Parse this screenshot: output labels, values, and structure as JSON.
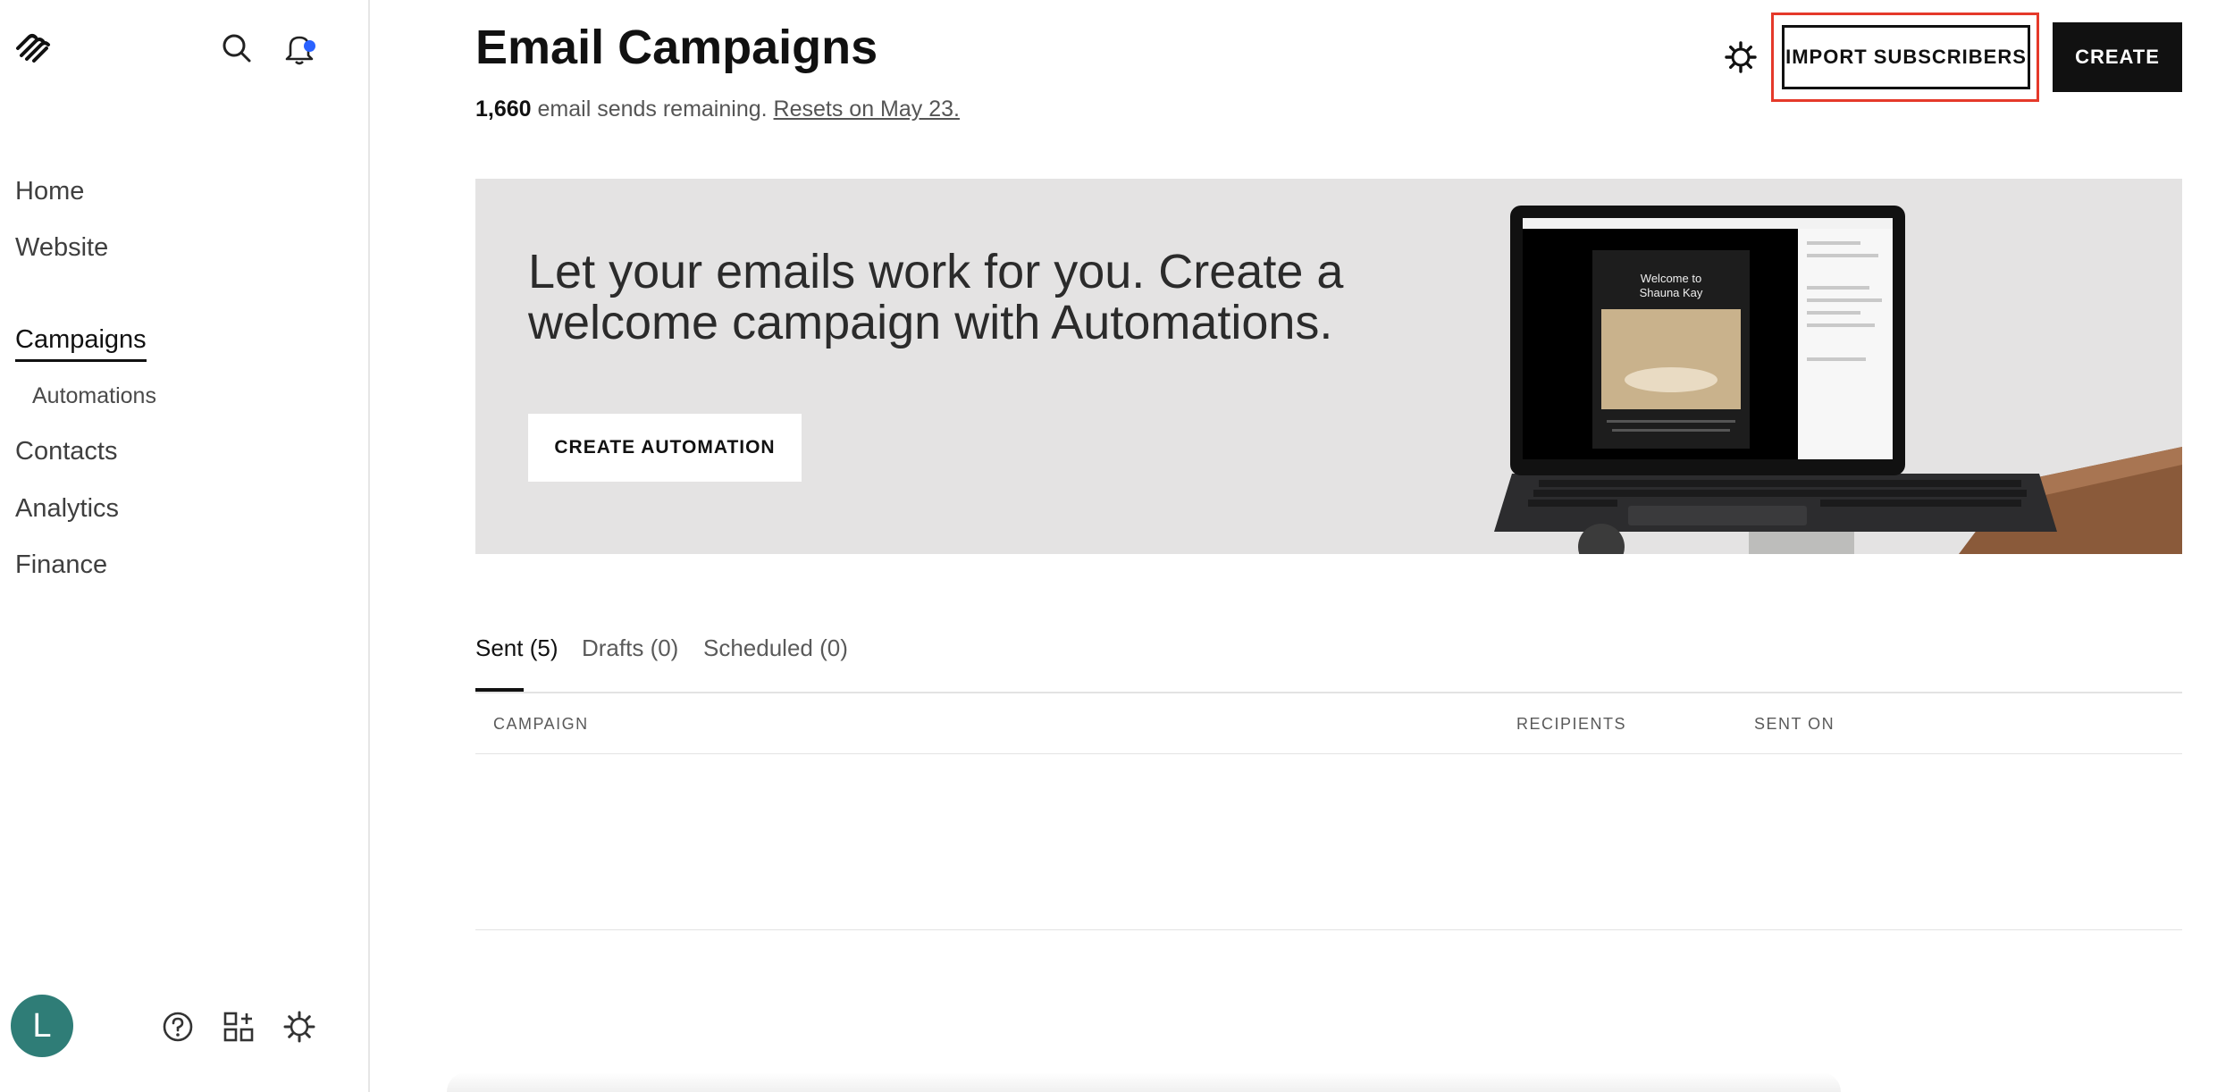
{
  "sidebar": {
    "nav": [
      {
        "label": "Home"
      },
      {
        "label": "Website"
      },
      {
        "label": "Campaigns"
      },
      {
        "label": "Automations"
      },
      {
        "label": "Contacts"
      },
      {
        "label": "Analytics"
      },
      {
        "label": "Finance"
      }
    ],
    "avatar_initial": "L",
    "notification_dot_color": "#2a62ff",
    "avatar_color": "#2f7d77",
    "icons": [
      "squarespace-logo",
      "search-icon",
      "bell-icon",
      "help-icon",
      "apps-add-icon",
      "settings-gear-icon"
    ]
  },
  "header": {
    "title": "Email Campaigns",
    "sends_count": "1,660",
    "sends_text": " email sends remaining. ",
    "reset_link": "Resets on May 23.",
    "import_label": "IMPORT SUBSCRIBERS",
    "create_label": "CREATE",
    "highlight_color": "#e5392a"
  },
  "banner": {
    "headline": "Let your emails work for you. Create a welcome campaign with Automations.",
    "cta_label": "CREATE AUTOMATION",
    "email_preview": {
      "title_line1": "Welcome to",
      "title_line2": "Shauna Kay"
    }
  },
  "tabs": [
    {
      "label": "Sent (5)"
    },
    {
      "label": "Drafts (0)"
    },
    {
      "label": "Scheduled (0)"
    }
  ],
  "table": {
    "columns": [
      "CAMPAIGN",
      "RECIPIENTS",
      "SENT ON"
    ],
    "rows": []
  }
}
